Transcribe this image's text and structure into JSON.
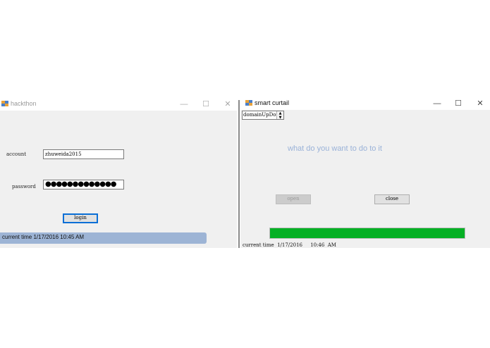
{
  "login_window": {
    "title": "hackthon",
    "controls": {
      "minimize": "—",
      "maximize": "☐",
      "close": "✕"
    },
    "account_label": "account",
    "account_value": "zhuweida2015",
    "password_label": "password",
    "password_value": "●●●●●●●●●●●●●",
    "login_button": "login",
    "status_text": "current time  1/17/2016  10:45 AM"
  },
  "curtain_window": {
    "title": "smart curtail",
    "controls": {
      "minimize": "—",
      "maximize": "☐",
      "close": "✕"
    },
    "domain_updown_value": "domainUpDown",
    "spin_up": "▲",
    "spin_down": "▼",
    "prompt": "what do you want to do to it",
    "open_button": "open",
    "close_button": "close",
    "progress_fraction": 1.0,
    "progress_color": "#06b025",
    "status_text": "current time  1/17/2016     10:46  AM"
  },
  "colors": {
    "status_bar": "#9db4d5",
    "prompt_text": "#9ab2d8",
    "focus_border": "#0a6fd6"
  },
  "icons": [
    "app-icon",
    "minimize-icon",
    "maximize-icon",
    "close-icon"
  ]
}
